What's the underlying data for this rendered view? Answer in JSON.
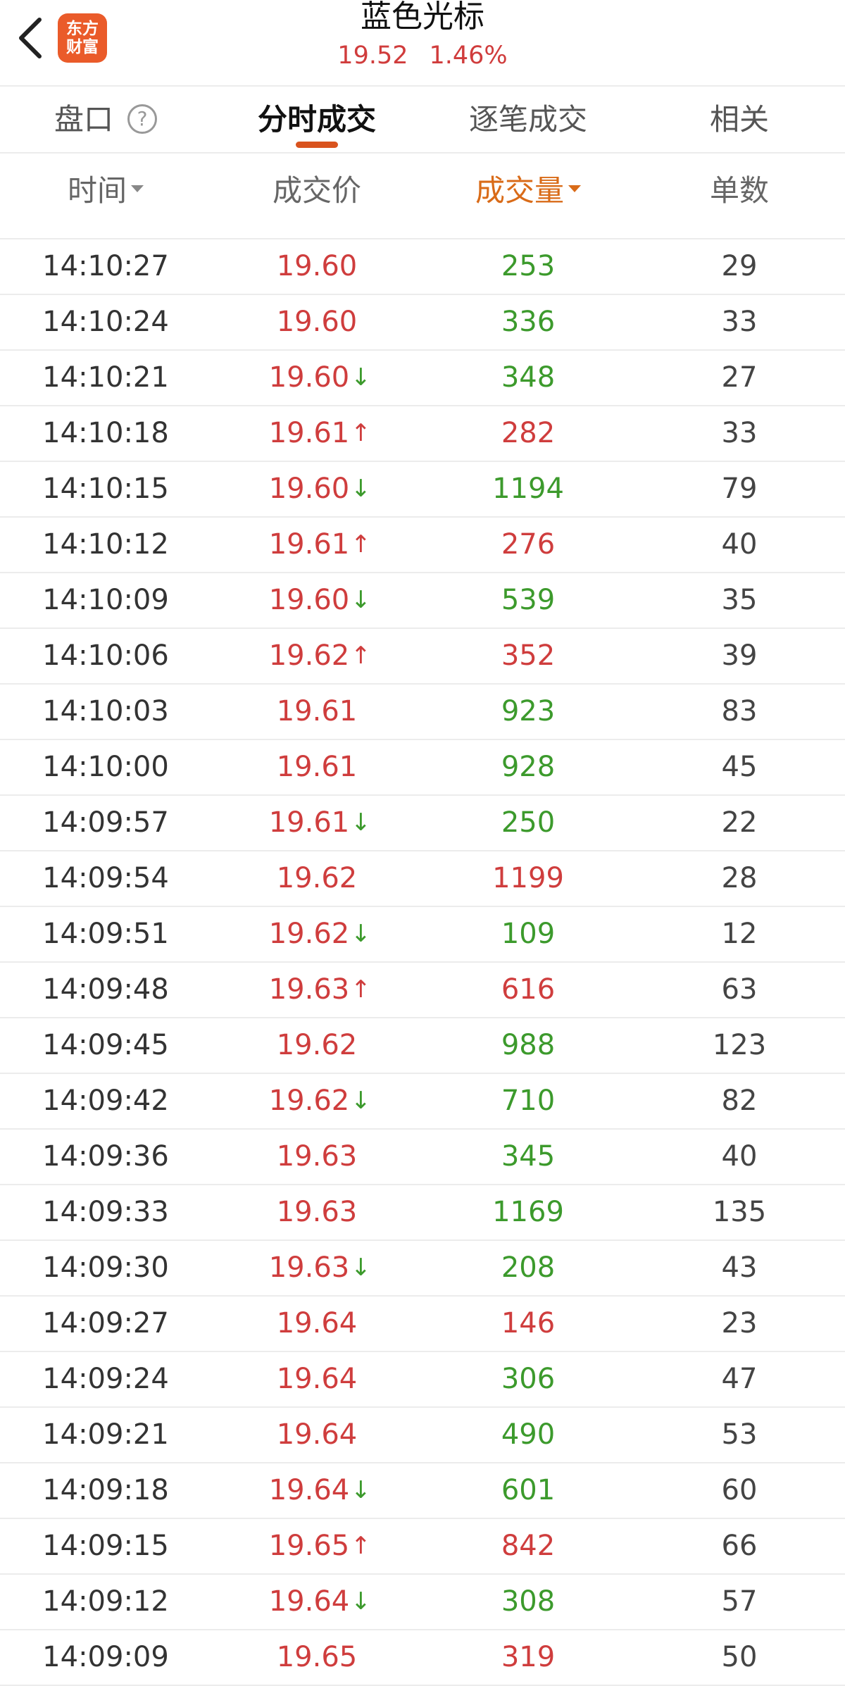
{
  "header": {
    "title": "蓝色光标",
    "price": "19.52",
    "change_pct": "1.46%",
    "logo_line1": "东方",
    "logo_line2": "财富"
  },
  "tabs": [
    {
      "label": "盘口"
    },
    {
      "label": "分时成交"
    },
    {
      "label": "逐笔成交"
    },
    {
      "label": "相关"
    }
  ],
  "help_icon": "?",
  "columns": {
    "time": "时间",
    "price": "成交价",
    "volume": "成交量",
    "count": "单数"
  },
  "colors": {
    "up": "#cf3d3d",
    "down": "#3c9a2c",
    "accent": "#d96b18",
    "logo": "#ea5b2a"
  },
  "rows": [
    {
      "time": "14:10:27",
      "price": "19.60",
      "arrow": "",
      "volume": "253",
      "vol_color": "green",
      "count": "29"
    },
    {
      "time": "14:10:24",
      "price": "19.60",
      "arrow": "",
      "volume": "336",
      "vol_color": "green",
      "count": "33"
    },
    {
      "time": "14:10:21",
      "price": "19.60",
      "arrow": "down",
      "volume": "348",
      "vol_color": "green",
      "count": "27"
    },
    {
      "time": "14:10:18",
      "price": "19.61",
      "arrow": "up",
      "volume": "282",
      "vol_color": "red",
      "count": "33"
    },
    {
      "time": "14:10:15",
      "price": "19.60",
      "arrow": "down",
      "volume": "1194",
      "vol_color": "green",
      "count": "79"
    },
    {
      "time": "14:10:12",
      "price": "19.61",
      "arrow": "up",
      "volume": "276",
      "vol_color": "red",
      "count": "40"
    },
    {
      "time": "14:10:09",
      "price": "19.60",
      "arrow": "down",
      "volume": "539",
      "vol_color": "green",
      "count": "35"
    },
    {
      "time": "14:10:06",
      "price": "19.62",
      "arrow": "up",
      "volume": "352",
      "vol_color": "red",
      "count": "39"
    },
    {
      "time": "14:10:03",
      "price": "19.61",
      "arrow": "",
      "volume": "923",
      "vol_color": "green",
      "count": "83"
    },
    {
      "time": "14:10:00",
      "price": "19.61",
      "arrow": "",
      "volume": "928",
      "vol_color": "green",
      "count": "45"
    },
    {
      "time": "14:09:57",
      "price": "19.61",
      "arrow": "down",
      "volume": "250",
      "vol_color": "green",
      "count": "22"
    },
    {
      "time": "14:09:54",
      "price": "19.62",
      "arrow": "",
      "volume": "1199",
      "vol_color": "red",
      "count": "28"
    },
    {
      "time": "14:09:51",
      "price": "19.62",
      "arrow": "down",
      "volume": "109",
      "vol_color": "green",
      "count": "12"
    },
    {
      "time": "14:09:48",
      "price": "19.63",
      "arrow": "up",
      "volume": "616",
      "vol_color": "red",
      "count": "63"
    },
    {
      "time": "14:09:45",
      "price": "19.62",
      "arrow": "",
      "volume": "988",
      "vol_color": "green",
      "count": "123"
    },
    {
      "time": "14:09:42",
      "price": "19.62",
      "arrow": "down",
      "volume": "710",
      "vol_color": "green",
      "count": "82"
    },
    {
      "time": "14:09:36",
      "price": "19.63",
      "arrow": "",
      "volume": "345",
      "vol_color": "green",
      "count": "40"
    },
    {
      "time": "14:09:33",
      "price": "19.63",
      "arrow": "",
      "volume": "1169",
      "vol_color": "green",
      "count": "135"
    },
    {
      "time": "14:09:30",
      "price": "19.63",
      "arrow": "down",
      "volume": "208",
      "vol_color": "green",
      "count": "43"
    },
    {
      "time": "14:09:27",
      "price": "19.64",
      "arrow": "",
      "volume": "146",
      "vol_color": "red",
      "count": "23"
    },
    {
      "time": "14:09:24",
      "price": "19.64",
      "arrow": "",
      "volume": "306",
      "vol_color": "green",
      "count": "47"
    },
    {
      "time": "14:09:21",
      "price": "19.64",
      "arrow": "",
      "volume": "490",
      "vol_color": "green",
      "count": "53"
    },
    {
      "time": "14:09:18",
      "price": "19.64",
      "arrow": "down",
      "volume": "601",
      "vol_color": "green",
      "count": "60"
    },
    {
      "time": "14:09:15",
      "price": "19.65",
      "arrow": "up",
      "volume": "842",
      "vol_color": "red",
      "count": "66"
    },
    {
      "time": "14:09:12",
      "price": "19.64",
      "arrow": "down",
      "volume": "308",
      "vol_color": "green",
      "count": "57"
    },
    {
      "time": "14:09:09",
      "price": "19.65",
      "arrow": "",
      "volume": "319",
      "vol_color": "red",
      "count": "50"
    }
  ]
}
